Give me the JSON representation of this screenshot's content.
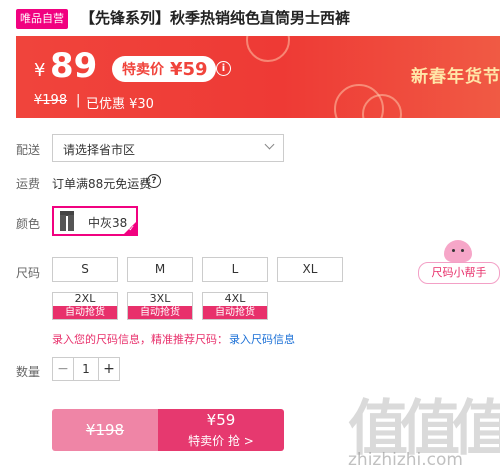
{
  "product": {
    "badge": "唯品自营",
    "title": "【先锋系列】秋季热销纯色直筒男士西裤"
  },
  "price": {
    "currency": "¥",
    "current": "89",
    "special_label": "特卖价",
    "special_value": "¥59",
    "original": "¥198",
    "separator": "|",
    "saved": "已优惠 ¥30",
    "festival": "新春年货节"
  },
  "delivery": {
    "label": "配送",
    "placeholder": "请选择省市区"
  },
  "shipping": {
    "label": "运费",
    "text": "订单满88元免运费"
  },
  "color": {
    "label": "颜色",
    "selected": "中灰38"
  },
  "size": {
    "label": "尺码",
    "row1": [
      "S",
      "M",
      "L",
      "XL"
    ],
    "row2": [
      "2XL",
      "3XL",
      "4XL"
    ],
    "auto_grab": "自动抢货",
    "helper": "尺码小帮手",
    "tip": "录入您的尺码信息，精准推荐尺码：",
    "tip_link": "录入尺码信息"
  },
  "quantity": {
    "label": "数量",
    "value": "1",
    "minus": "−",
    "plus": "+"
  },
  "buy": {
    "original": "¥198",
    "price": "¥59",
    "label": "特卖价 抢 >"
  },
  "watermark": {
    "logo": "值值值",
    "url": "zhizhizhi.com"
  },
  "colors": {
    "accent": "#f10180",
    "banner": "#f0443c",
    "buy_button": "#e6396f",
    "link": "#1a6fd6"
  }
}
